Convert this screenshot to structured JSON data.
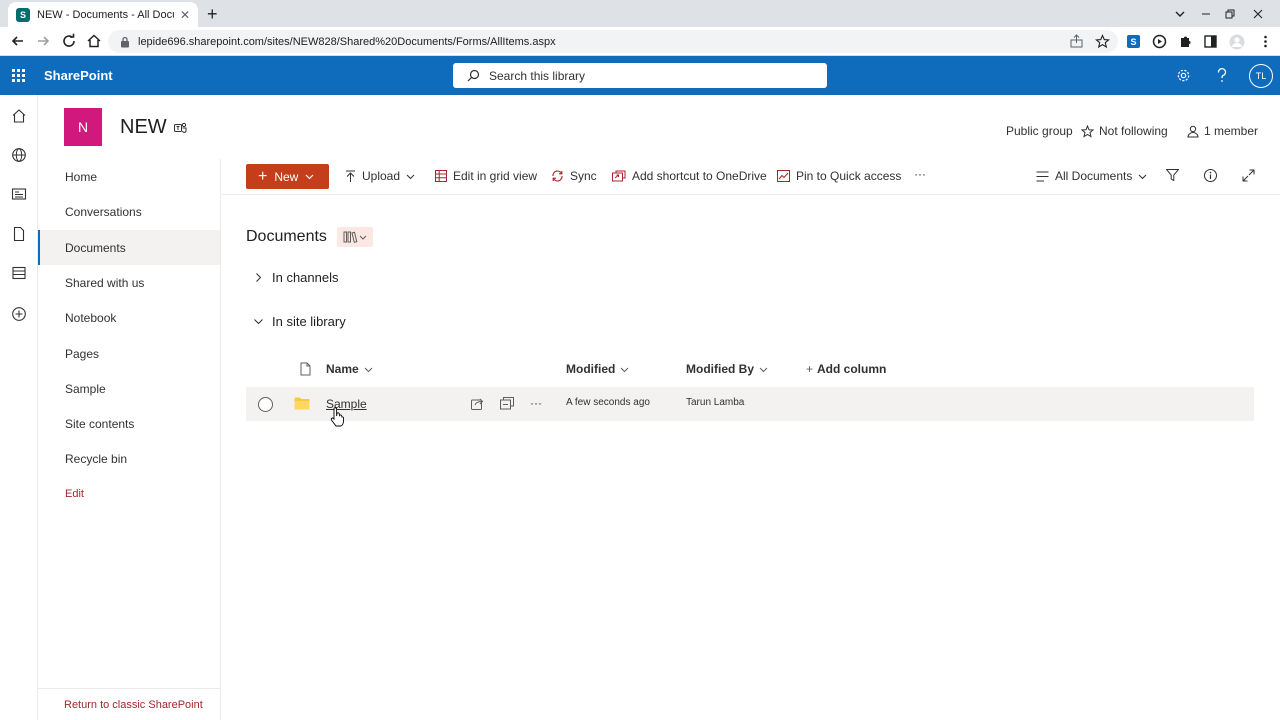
{
  "browser": {
    "tab_title": "NEW - Documents - All Docume",
    "favicon_letter": "S",
    "url": "lepide696.sharepoint.com/sites/NEW828/Shared%20Documents/Forms/AllItems.aspx"
  },
  "suite": {
    "brand": "SharePoint",
    "search_placeholder": "Search this library",
    "user_initials": "TL",
    "color": "#0f6cbd"
  },
  "site": {
    "logo_letter": "N",
    "logo_color": "#d1197d",
    "title": "NEW",
    "group_type": "Public group",
    "follow_label": "Not following",
    "member_count": "1 member"
  },
  "nav": {
    "items": [
      {
        "label": "Home"
      },
      {
        "label": "Conversations"
      },
      {
        "label": "Documents",
        "selected": true
      },
      {
        "label": "Shared with us"
      },
      {
        "label": "Notebook"
      },
      {
        "label": "Pages"
      },
      {
        "label": "Sample"
      },
      {
        "label": "Site contents"
      },
      {
        "label": "Recycle bin"
      }
    ],
    "edit_label": "Edit",
    "classic_link": "Return to classic SharePoint"
  },
  "commands": {
    "new_label": "New",
    "upload": "Upload",
    "grid_view": "Edit in grid view",
    "sync": "Sync",
    "shortcut": "Add shortcut to OneDrive",
    "pin": "Pin to Quick access",
    "more": "···",
    "view_name": "All Documents"
  },
  "library": {
    "title": "Documents",
    "groups": [
      {
        "label": "In channels",
        "expanded": false
      },
      {
        "label": "In site library",
        "expanded": true
      }
    ],
    "columns": {
      "name": "Name",
      "modified": "Modified",
      "modified_by": "Modified By",
      "add_column": "Add column"
    },
    "rows": [
      {
        "name": "Sample",
        "type": "folder",
        "modified": "A few seconds ago",
        "modified_by": "Tarun Lamba"
      }
    ]
  }
}
